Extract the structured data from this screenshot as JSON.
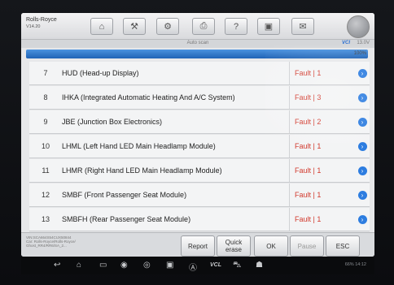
{
  "header": {
    "brand": "Rolls-Royce",
    "model": "V14.20",
    "toolbar_icons": [
      "home-icon",
      "car-icon",
      "gear-icon",
      "printer-icon",
      "help-icon",
      "save-icon",
      "message-icon"
    ]
  },
  "subbar": {
    "title": "Auto scan",
    "vci": "VCI",
    "battery": "13.0V"
  },
  "progress": {
    "percent_label": "100%",
    "value": 1.0
  },
  "rows": [
    {
      "no": "7",
      "name": "HUD (Head-up Display)",
      "status": "Fault | 1"
    },
    {
      "no": "8",
      "name": "IHKA (Integrated Automatic Heating And A/C System)",
      "status": "Fault | 3"
    },
    {
      "no": "9",
      "name": "JBE (Junction Box Electronics)",
      "status": "Fault | 2"
    },
    {
      "no": "10",
      "name": "LHML (Left Hand LED Main Headlamp Module)",
      "status": "Fault | 1"
    },
    {
      "no": "11",
      "name": "LHMR (Right Hand LED Main Headlamp Module)",
      "status": "Fault | 1"
    },
    {
      "no": "12",
      "name": "SMBF (Front Passenger Seat Module)",
      "status": "Fault | 1"
    },
    {
      "no": "13",
      "name": "SMBFH (Rear Passenger Seat Module)",
      "status": "Fault | 1"
    }
  ],
  "vehicle_info": {
    "vin": "VIN:SCA664S54CUX50844",
    "car": "Car: Rolls-Royce/Rolls-Royce/",
    "system": "Ghost_RR4/RR6/SA_2..."
  },
  "buttons": {
    "report": "Report",
    "quick_erase": "Quick erase",
    "ok": "OK",
    "pause": "Pause",
    "esc": "ESC"
  },
  "navbar": {
    "icons": [
      "back-icon",
      "home-icon",
      "window-icon",
      "browser-icon",
      "camera-icon",
      "screen-icon",
      "autel-icon",
      "vci-icon",
      "car-icon",
      "diag-icon"
    ],
    "vcl_label": "VCL",
    "status": "66% 14:12"
  }
}
